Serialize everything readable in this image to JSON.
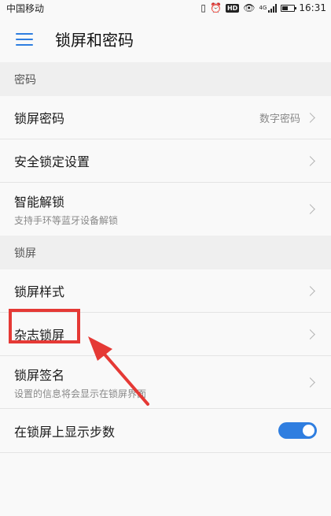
{
  "status_bar": {
    "carrier": "中国移动",
    "network": "4G",
    "time": "16:31",
    "battery_percent": 45
  },
  "header": {
    "title": "锁屏和密码"
  },
  "sections": {
    "password": {
      "header": "密码",
      "lock_password": {
        "label": "锁屏密码",
        "value": "数字密码"
      },
      "security_lock": {
        "label": "安全锁定设置"
      },
      "smart_unlock": {
        "label": "智能解锁",
        "subtitle": "支持手环等蓝牙设备解锁"
      }
    },
    "lockscreen": {
      "header": "锁屏",
      "style": {
        "label": "锁屏样式"
      },
      "magazine": {
        "label": "杂志锁屏"
      },
      "signature": {
        "label": "锁屏签名",
        "subtitle": "设置的信息将会显示在锁屏界面"
      },
      "steps": {
        "label": "在锁屏上显示步数",
        "enabled": true
      }
    }
  },
  "colors": {
    "accent": "#2f7ee0",
    "highlight": "#e53935"
  }
}
